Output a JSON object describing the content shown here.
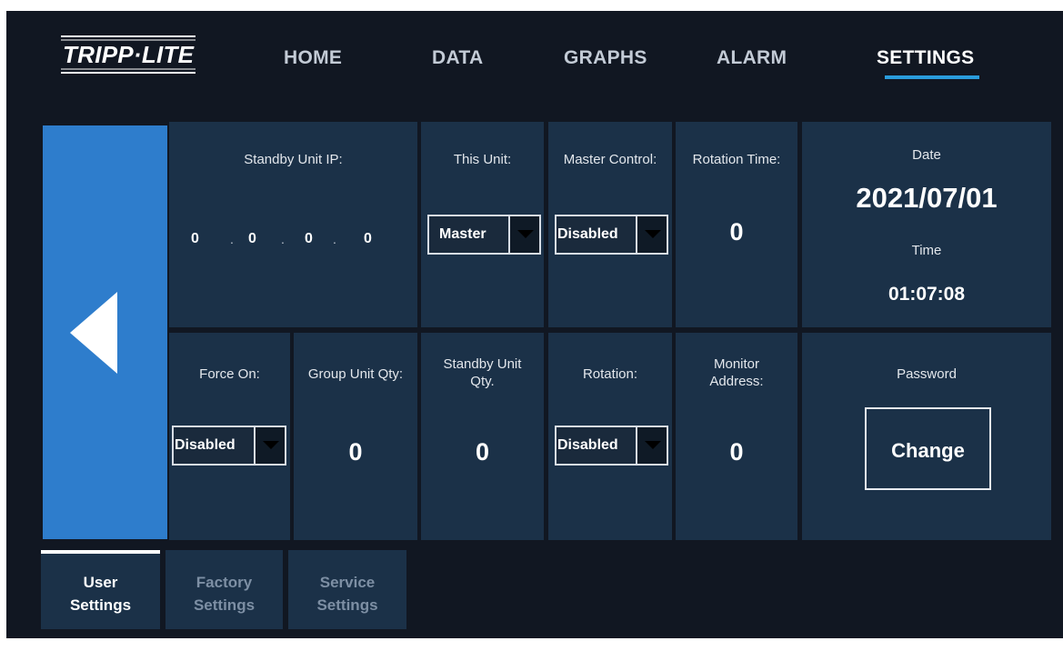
{
  "brand": {
    "logo_text": "TRIPP·LITE"
  },
  "nav": {
    "home": "HOME",
    "data": "DATA",
    "graphs": "GRAPHS",
    "alarm": "ALARM",
    "settings": "SETTINGS",
    "active": "SETTINGS"
  },
  "settings": {
    "standby_ip": {
      "label": "Standby Unit IP:",
      "octets": [
        "0",
        "0",
        "0",
        "0"
      ],
      "dots": [
        ".",
        ".",
        "."
      ]
    },
    "this_unit": {
      "label": "This Unit:",
      "value": "Master"
    },
    "master_control": {
      "label": "Master Control:",
      "value": "Disabled"
    },
    "rotation_time": {
      "label": "Rotation Time:",
      "value": "0"
    },
    "date": {
      "label": "Date",
      "value": "2021/07/01"
    },
    "time": {
      "label": "Time",
      "value": "01:07:08"
    },
    "force_on": {
      "label": "Force On:",
      "value": "Disabled"
    },
    "group_unit_qty": {
      "label": "Group Unit Qty:",
      "value": "0"
    },
    "standby_unit_qty": {
      "label_line1": "Standby Unit",
      "label_line2": "Qty.",
      "value": "0"
    },
    "rotation": {
      "label": "Rotation:",
      "value": "Disabled"
    },
    "monitor_address": {
      "label_line1": "Monitor",
      "label_line2": "Address:",
      "value": "0"
    },
    "password": {
      "label": "Password",
      "button": "Change"
    }
  },
  "tabs": [
    {
      "line1": "User",
      "line2": "Settings",
      "active": true
    },
    {
      "line1": "Factory",
      "line2": "Settings",
      "active": false
    },
    {
      "line1": "Service",
      "line2": "Settings",
      "active": false
    }
  ],
  "colors": {
    "background": "#111722",
    "tile": "#1b3148",
    "accent_blue": "#2e7dcc",
    "nav_underline": "#2a9cdc"
  },
  "icons": {
    "back": "left-triangle-icon",
    "dropdown": "caret-down-icon"
  }
}
